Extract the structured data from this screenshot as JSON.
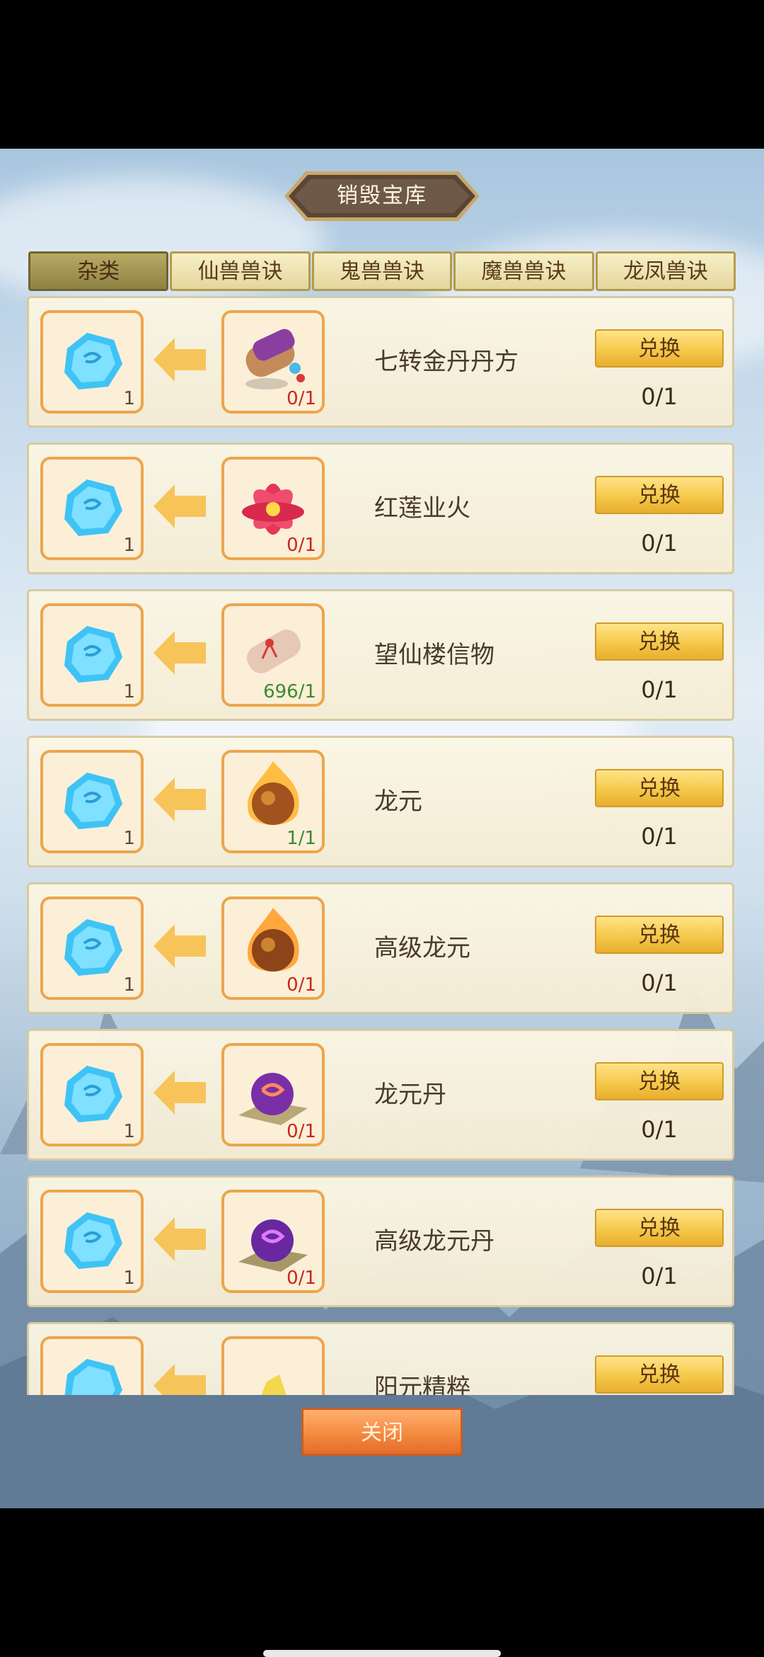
{
  "dialog": {
    "title": "销毁宝库",
    "close_label": "关闭"
  },
  "tabs": [
    {
      "label": "杂类",
      "active": true
    },
    {
      "label": "仙兽兽诀",
      "active": false
    },
    {
      "label": "鬼兽兽诀",
      "active": false
    },
    {
      "label": "魔兽兽诀",
      "active": false
    },
    {
      "label": "龙凤兽诀",
      "active": false
    }
  ],
  "reward": {
    "icon": "blue-crystal-icon",
    "count": "1"
  },
  "items": [
    {
      "name": "七转金丹丹方",
      "icon": "scroll-pouch-icon",
      "owned": "0/1",
      "owned_color": "red",
      "button": "兑换",
      "progress": "0/1"
    },
    {
      "name": "红莲业火",
      "icon": "red-lotus-icon",
      "owned": "0/1",
      "owned_color": "red",
      "button": "兑换",
      "progress": "0/1"
    },
    {
      "name": "望仙楼信物",
      "icon": "paper-scroll-icon",
      "owned": "696/1",
      "owned_color": "green",
      "button": "兑换",
      "progress": "0/1"
    },
    {
      "name": "龙元",
      "icon": "fire-orb-icon",
      "owned": "1/1",
      "owned_color": "green",
      "button": "兑换",
      "progress": "0/1"
    },
    {
      "name": "高级龙元",
      "icon": "fire-orb-icon",
      "owned": "0/1",
      "owned_color": "red",
      "button": "兑换",
      "progress": "0/1"
    },
    {
      "name": "龙元丹",
      "icon": "purple-pill-icon",
      "owned": "0/1",
      "owned_color": "red",
      "button": "兑换",
      "progress": "0/1"
    },
    {
      "name": "高级龙元丹",
      "icon": "purple-pill-icon",
      "owned": "0/1",
      "owned_color": "red",
      "button": "兑换",
      "progress": "0/1"
    },
    {
      "name": "阳元精粹",
      "icon": "gold-essence-icon",
      "owned": "",
      "owned_color": "red",
      "button": "兑换",
      "progress": ""
    }
  ],
  "colors": {
    "slot_border": "#eda54c",
    "button_gold": "#f5c84a",
    "close_orange": "#f48a40",
    "count_red": "#c8281e",
    "count_green": "#3d8a2e"
  }
}
